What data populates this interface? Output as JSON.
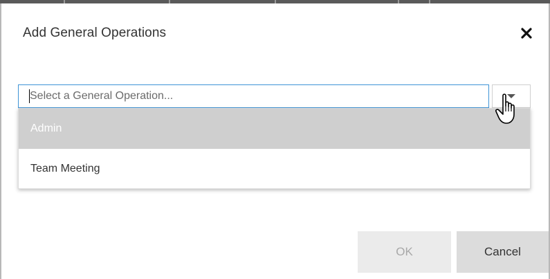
{
  "dialog": {
    "title": "Add General Operations",
    "close_icon": "close-icon"
  },
  "combo": {
    "placeholder": "Select a General Operation...",
    "value": "",
    "toggle_icon": "chevron-down-icon"
  },
  "dropdown": {
    "options": [
      {
        "label": "Admin",
        "highlighted": true
      },
      {
        "label": "Team Meeting",
        "highlighted": false
      }
    ]
  },
  "footer": {
    "ok_label": "OK",
    "ok_enabled": false,
    "cancel_label": "Cancel"
  },
  "colors": {
    "focus_border": "#3d93d6",
    "highlight_bg": "#cfcfcf",
    "ok_bg": "#ebebeb",
    "cancel_bg": "#dcdcdc"
  }
}
